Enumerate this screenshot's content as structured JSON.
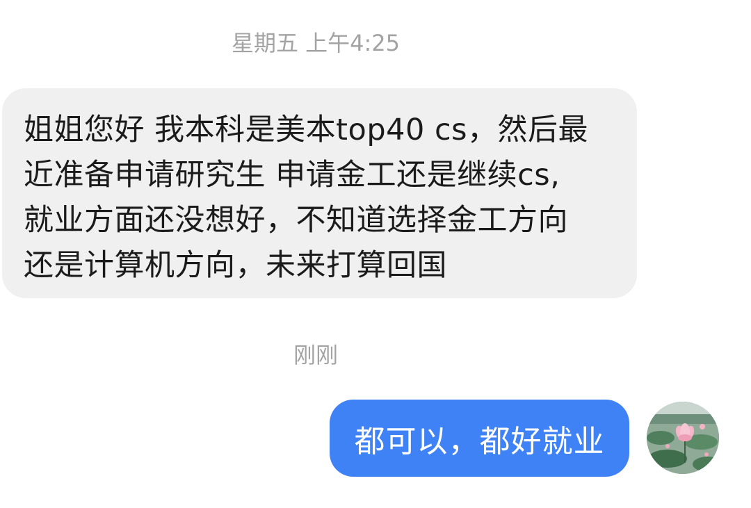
{
  "conversation": {
    "messages": [
      {
        "timestamp": "星期五 上午4:25",
        "direction": "incoming",
        "lines": [
          "姐姐您好 我本科是美本top40 cs，然后最",
          "近准备申请研究生 申请金工还是继续cs,",
          "就业方面还没想好，不知道选择金工方向",
          "还是计算机方向，未来打算回国"
        ]
      },
      {
        "timestamp": "刚刚",
        "direction": "outgoing",
        "text": "都可以，都好就业"
      }
    ]
  },
  "avatar": {
    "icon": "lotus-pond-photo"
  },
  "colors": {
    "incoming_bubble": "#f0f0f0",
    "outgoing_bubble": "#3f82f5",
    "timestamp_text": "#a3a3a3",
    "message_text": "#1b1b1b"
  }
}
